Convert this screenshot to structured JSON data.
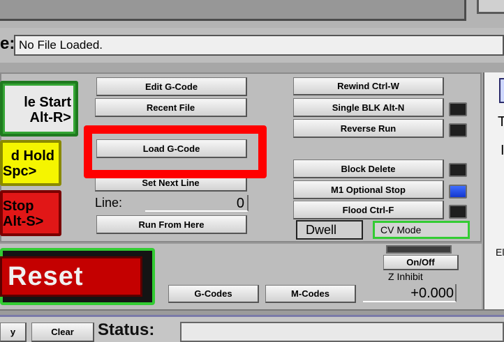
{
  "file": {
    "label_fragment": "e:",
    "value": "No File Loaded."
  },
  "left_buttons": {
    "cycle_start": [
      "le Start",
      "Alt-R>"
    ],
    "feed_hold": [
      "d Hold",
      "Spc>"
    ],
    "stop": [
      "Stop",
      "Alt-S>"
    ]
  },
  "center_buttons": {
    "edit_gcode": "Edit G-Code",
    "recent_file": "Recent File",
    "load_gcode": "Load G-Code",
    "set_next_line": "Set Next Line",
    "run_from_here": "Run From Here"
  },
  "line": {
    "label": "Line:",
    "value": "0"
  },
  "right_buttons": {
    "rewind": "Rewind Ctrl-W",
    "single_blk": "Single BLK Alt-N",
    "reverse_run": "Reverse Run",
    "block_delete": "Block Delete",
    "m1_optional_stop": "M1 Optional Stop",
    "flood": "Flood Ctrl-F"
  },
  "indicators": {
    "single_blk": "off",
    "reverse_run": "off",
    "block_delete": "off",
    "m1_optional_stop": "on",
    "flood": "off"
  },
  "dwell": "Dwell",
  "cv_mode": "CV Mode",
  "reset": "Reset",
  "bottom_buttons": {
    "gcodes": "G-Codes",
    "mcodes": "M-Codes",
    "onoff": "On/Off"
  },
  "z_inhibit": {
    "label": "Z Inhibit",
    "value": "+0.000"
  },
  "right_panel": {
    "t": "T",
    "i": "I",
    "el": "El"
  },
  "status": {
    "left_fragment": "y",
    "clear": "Clear",
    "label": "Status:"
  },
  "colors": {
    "highlight": "#ff0000",
    "led_on": "#1e4fff",
    "reset": "#c40000",
    "cv_border": "#33cc33"
  }
}
